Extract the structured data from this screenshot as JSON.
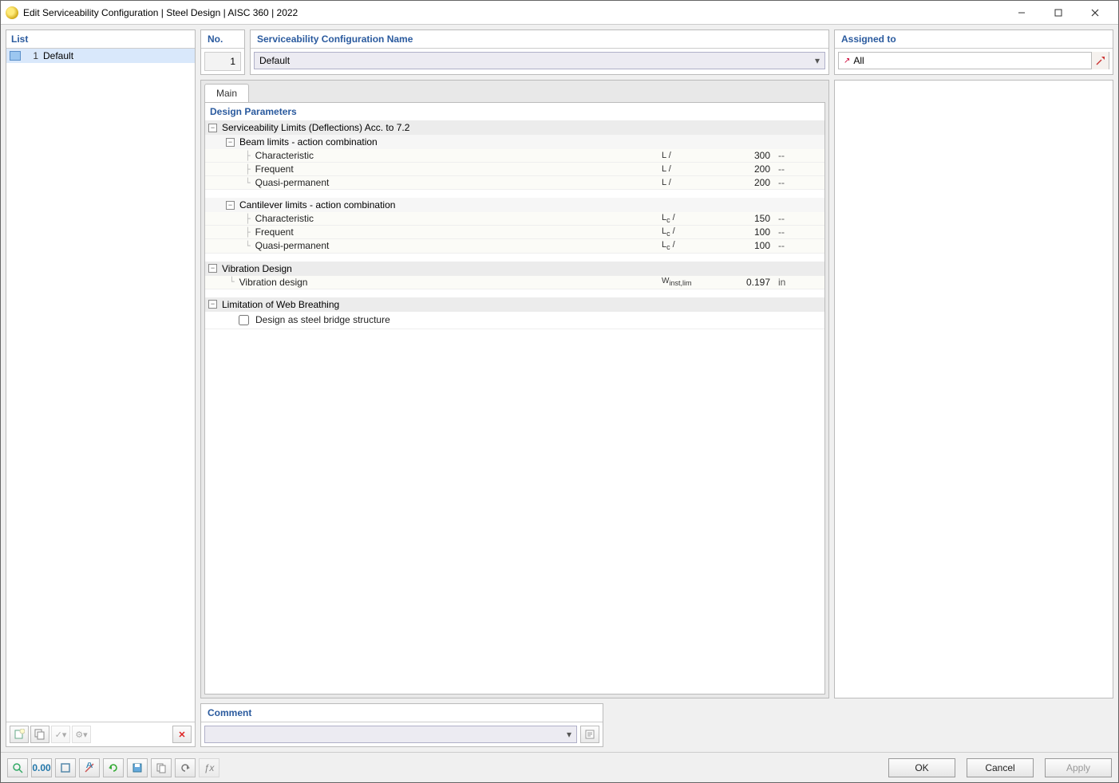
{
  "window": {
    "title": "Edit Serviceability Configuration | Steel Design | AISC 360 | 2022"
  },
  "list": {
    "header": "List",
    "items": [
      {
        "index": "1",
        "name": "Default"
      }
    ]
  },
  "no": {
    "header": "No.",
    "value": "1"
  },
  "config_name": {
    "header": "Serviceability Configuration Name",
    "value": "Default"
  },
  "assigned": {
    "header": "Assigned to",
    "value": "All"
  },
  "tab_main": "Main",
  "design_params_title": "Design Parameters",
  "group1": "Serviceability Limits (Deflections) Acc. to 7.2",
  "subgroup_beam": "Beam limits - action combination",
  "beam": {
    "characteristic": {
      "label": "Characteristic",
      "mid": "L /",
      "val": "300",
      "unit": "--"
    },
    "frequent": {
      "label": "Frequent",
      "mid": "L /",
      "val": "200",
      "unit": "--"
    },
    "quasi": {
      "label": "Quasi-permanent",
      "mid": "L /",
      "val": "200",
      "unit": "--"
    }
  },
  "subgroup_cant": "Cantilever limits - action combination",
  "cant": {
    "characteristic": {
      "label": "Characteristic",
      "mid": "Lc /",
      "val": "150",
      "unit": "--"
    },
    "frequent": {
      "label": "Frequent",
      "mid": "Lc /",
      "val": "100",
      "unit": "--"
    },
    "quasi": {
      "label": "Quasi-permanent",
      "mid": "Lc /",
      "val": "100",
      "unit": "--"
    }
  },
  "group_vib": "Vibration Design",
  "vib": {
    "label": "Vibration design",
    "mid": "Winst,lim",
    "val": "0.197",
    "unit": "in"
  },
  "group_web": "Limitation of Web Breathing",
  "web_check": "Design as steel bridge structure",
  "comment_header": "Comment",
  "buttons": {
    "ok": "OK",
    "cancel": "Cancel",
    "apply": "Apply"
  }
}
